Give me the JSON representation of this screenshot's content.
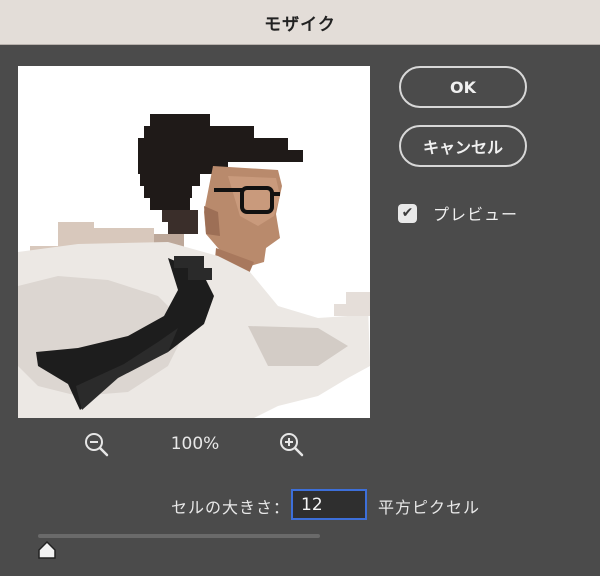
{
  "dialog": {
    "title": "モザイク"
  },
  "buttons": {
    "ok_label": "OK",
    "cancel_label": "キャンセル"
  },
  "preview_toggle": {
    "label": "プレビュー",
    "checked": true
  },
  "zoom": {
    "level_text": "100%"
  },
  "cell_size": {
    "label": "セルの大きさ：",
    "value": "12",
    "unit_label": "平方ピクセル",
    "slider_fraction": 0.02
  },
  "icons": {
    "zoom_out": "zoom-out-icon",
    "zoom_in": "zoom-in-icon",
    "checkmark": "checkmark-icon"
  }
}
